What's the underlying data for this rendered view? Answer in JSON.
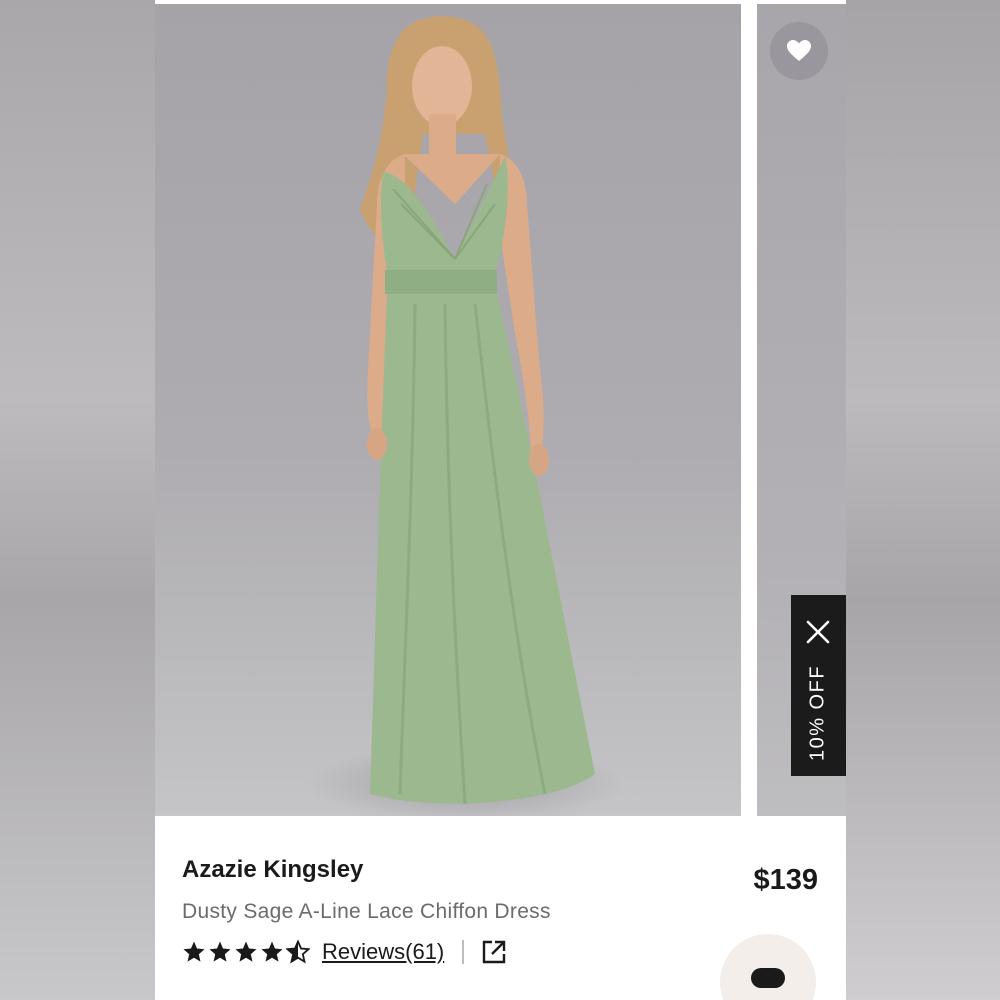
{
  "product": {
    "brand": "Azazie Kingsley",
    "name": "Dusty Sage A-Line Lace Chiffon Dress",
    "price": "$139",
    "rating": 4.5,
    "reviews_label": "Reviews(61)",
    "dress_color": "#9bb88f"
  },
  "promo": {
    "label": "10% OFF"
  },
  "icons": {
    "favorite": "heart-icon",
    "close": "close-icon",
    "share": "external-link-icon",
    "chat": "chat-icon"
  },
  "colors": {
    "price_text": "#1a1a1a",
    "subtitle_text": "#6b6b6b",
    "promo_bg": "#1b1b1b",
    "star_fill": "#1a1a1a"
  }
}
